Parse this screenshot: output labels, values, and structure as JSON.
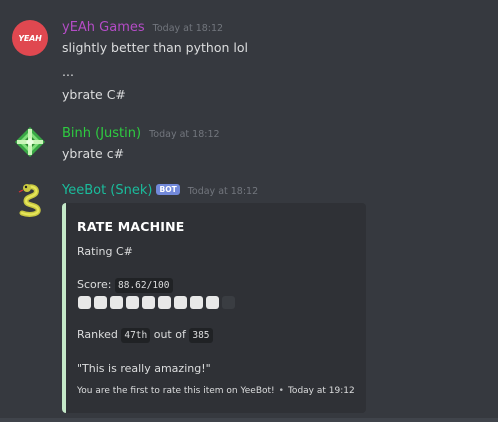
{
  "messages": [
    {
      "username": "yEAh Games",
      "username_color": "#b44cc6",
      "timestamp": "Today at 18:12",
      "avatar_text": "YEAH",
      "lines": [
        "slightly better than python lol",
        "...",
        "ybrate C#"
      ]
    },
    {
      "username": "Binh (Justin)",
      "username_color": "#2ecc40",
      "timestamp": "Today at 18:12",
      "avatar_icon": "green-diamond-icon",
      "lines": [
        "ybrate c#"
      ]
    },
    {
      "username": "YeeBot (Snek)",
      "username_color": "#1abc9c",
      "bot_tag": "BOT",
      "timestamp": "Today at 18:12",
      "avatar_icon": "snake-icon"
    }
  ],
  "embed": {
    "title": "RATE MACHINE",
    "subtitle": "Rating C#",
    "score_label": "Score:",
    "score_value": "88.62/100",
    "score_fraction": 0.8862,
    "score_cells_filled": 9,
    "score_cells_total": 10,
    "ranked_label": "Ranked",
    "rank_value": "47th",
    "out_of_label": "out of",
    "total_value": "385",
    "quote": "\"This is really amazing!\"",
    "footer_text": "You are the first to rate this item on YeeBot!",
    "footer_separator": "•",
    "footer_timestamp": "Today at 19:12",
    "accent_color": "#c4e8c8"
  }
}
